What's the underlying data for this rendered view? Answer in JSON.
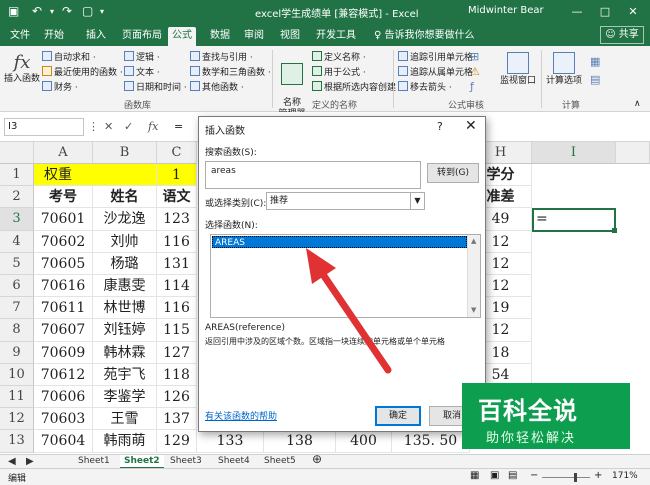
{
  "window": {
    "title": "excel学生成绩单 [兼容模式] - Excel",
    "user": "Midwinter Bear",
    "share_label": "共享",
    "share_icon": "person-icon",
    "min_label": "—",
    "max_label": "□",
    "close_label": "✕"
  },
  "tabs": [
    "文件",
    "开始",
    "插入",
    "页面布局",
    "公式",
    "数据",
    "审阅",
    "视图",
    "开发工具"
  ],
  "active_tab": "公式",
  "tell_me": "告诉我你想要做什么",
  "ribbon": {
    "insert_fn": "插入函数",
    "group1": [
      "自动求和 ·",
      "最近使用的函数 ·",
      "财务 ·"
    ],
    "group2": [
      "逻辑 ·",
      "文本 ·",
      "日期和时间 ·"
    ],
    "group3": [
      "查找与引用 ·",
      "数学和三角函数 ·",
      "其他函数 ·"
    ],
    "library_label": "函数库",
    "name_mgr": "名称\n管理器",
    "group4": [
      "定义名称 ·",
      "用于公式 ·",
      "根据所选内容创建"
    ],
    "names_label": "定义的名称",
    "group5": [
      "追踪引用单元格",
      "追踪从属单元格",
      "移去箭头 ·"
    ],
    "audit_label": "公式审核",
    "watch": "监视窗口",
    "calc_opts": "计算选项",
    "calc_label": "计算"
  },
  "formula_bar": {
    "name_box": "I3",
    "value": "="
  },
  "columns": [
    "A",
    "B",
    "C",
    "H",
    "I"
  ],
  "rows": [
    "1",
    "2",
    "3",
    "4",
    "5",
    "6",
    "7",
    "8",
    "9",
    "10",
    "11",
    "12",
    "13"
  ],
  "sheet": {
    "r1": {
      "a": "权重",
      "c": "1",
      "h": "学分"
    },
    "r2": {
      "a": "考号",
      "b": "姓名",
      "c": "语文",
      "h": "准差"
    },
    "data": [
      {
        "a": "70601",
        "b": "沙龙逸",
        "c": "123",
        "h": "49",
        "i": "="
      },
      {
        "a": "70602",
        "b": "刘帅",
        "c": "116",
        "h": "12"
      },
      {
        "a": "70605",
        "b": "杨璐",
        "c": "131",
        "h": "12"
      },
      {
        "a": "70616",
        "b": "康惠雯",
        "c": "114",
        "h": "12"
      },
      {
        "a": "70611",
        "b": "林世博",
        "c": "116",
        "h": "19"
      },
      {
        "a": "70607",
        "b": "刘钰婷",
        "c": "115",
        "h": "12"
      },
      {
        "a": "70609",
        "b": "韩林霖",
        "c": "127",
        "h": "18"
      },
      {
        "a": "70612",
        "b": "苑宇飞",
        "c": "118",
        "h": "54"
      },
      {
        "a": "70606",
        "b": "李鉴学",
        "c": "126",
        "h": ""
      },
      {
        "a": "70603",
        "b": "王雪",
        "c": "137",
        "h": ""
      },
      {
        "a": "70604",
        "b": "韩雨萌",
        "c": "129",
        "d": "133",
        "e": "138",
        "f": "400",
        "g": "135. 50"
      }
    ]
  },
  "sheet_tabs": [
    "Sheet1",
    "Sheet2",
    "Sheet3",
    "Sheet4",
    "Sheet5"
  ],
  "active_sheet": "Sheet2",
  "status": {
    "mode": "编辑",
    "zoom": "171%"
  },
  "dialog": {
    "title": "插入函数",
    "help": "?",
    "close": "✕",
    "search_label": "搜索函数(S):",
    "search_value": "areas",
    "go": "转到(G)",
    "category_label": "或选择类别(C):",
    "category_value": "推荐",
    "select_label": "选择函数(N):",
    "selected_fn": "AREAS",
    "signature": "AREAS(reference)",
    "description": "返回引用中涉及的区域个数。区域指一块连续的单元格或单个单元格",
    "help_link": "有关该函数的帮助",
    "ok": "确定",
    "cancel": "取消"
  },
  "watermark": {
    "line1": "百科全说",
    "line2": "助你轻松解决"
  },
  "colors": {
    "excel_green": "#217346",
    "yellow": "#ffff00",
    "arrow_red": "#e03232",
    "select_blue": "#0078d7",
    "watermark_green": "#0e9e4f"
  }
}
